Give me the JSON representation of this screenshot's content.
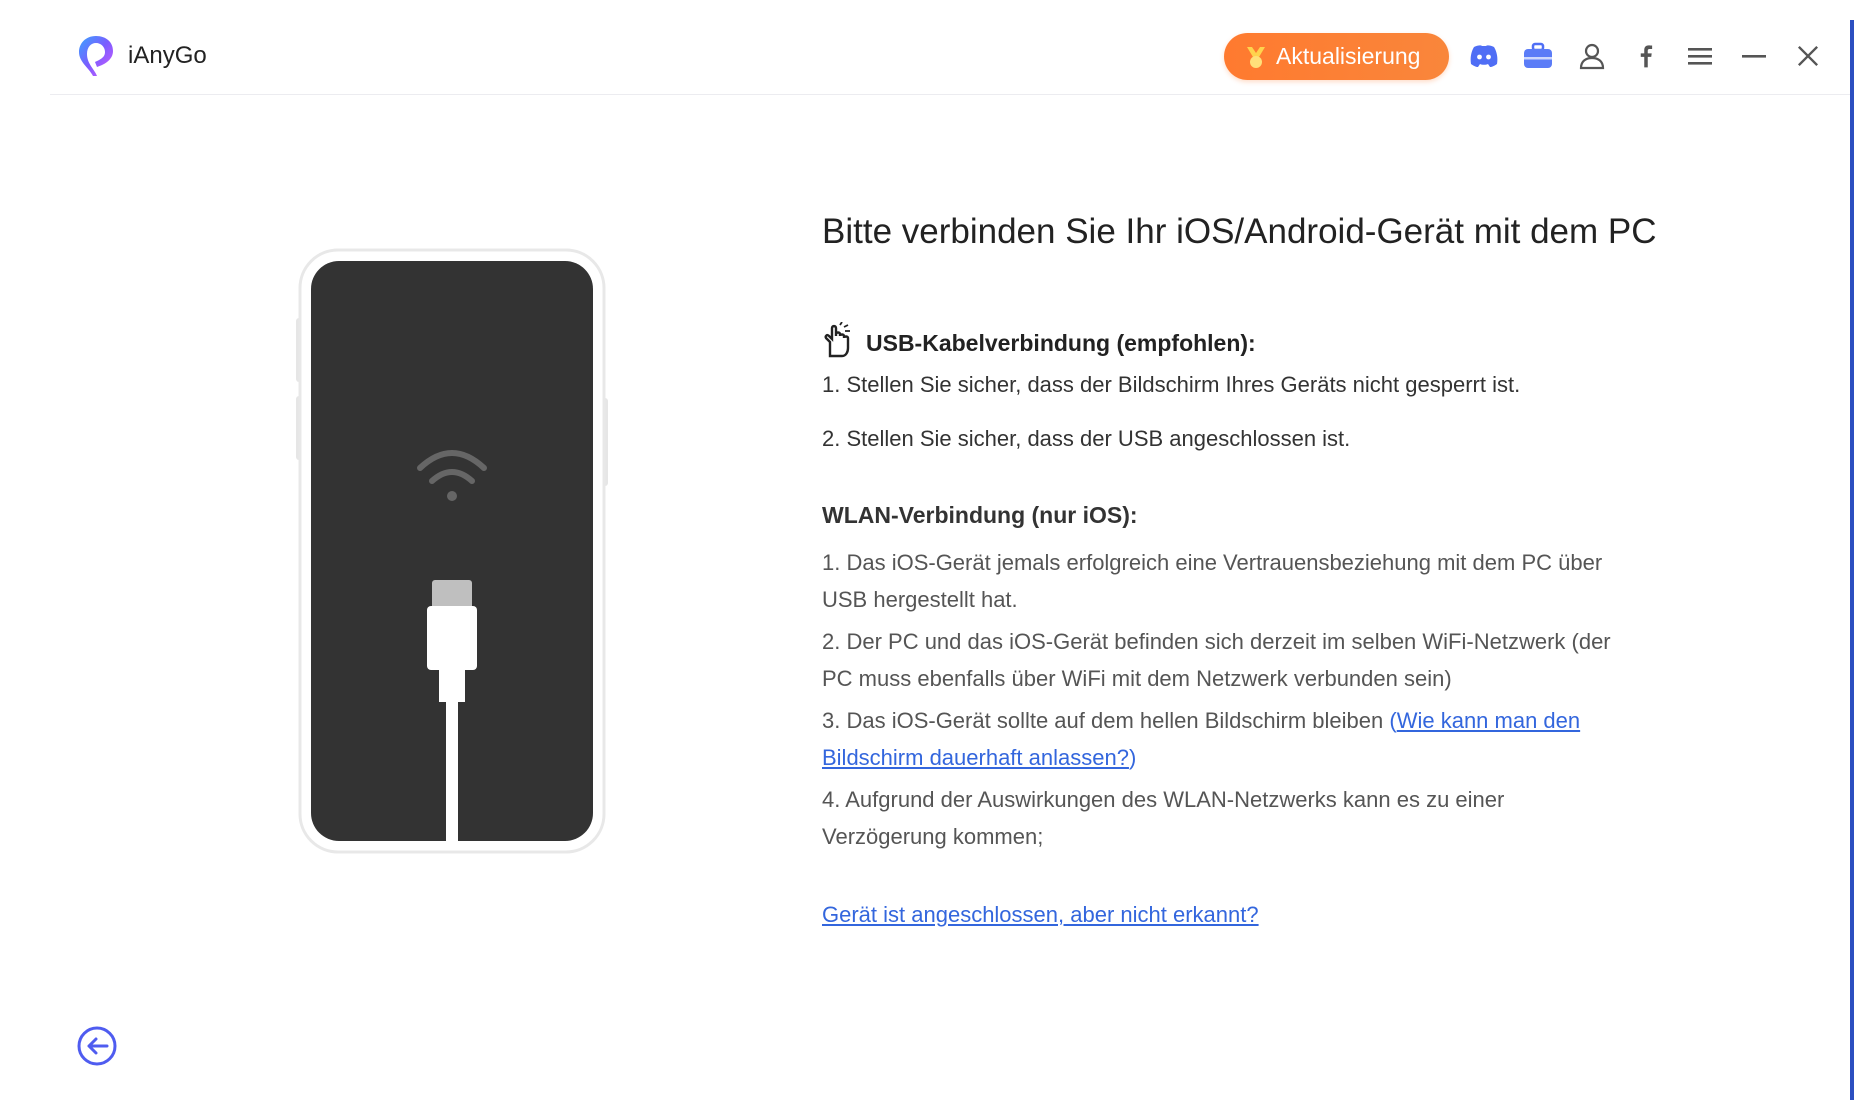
{
  "app": {
    "name": "iAnyGo"
  },
  "titlebar": {
    "upgrade_label": "Aktualisierung",
    "icons": [
      "discord-icon",
      "toolbox-icon",
      "user-icon",
      "facebook-icon",
      "menu-icon",
      "minimize-icon",
      "close-icon"
    ]
  },
  "colors": {
    "accent_orange": "#ff7a2f",
    "link_blue": "#3366dd",
    "phone_screen": "#333333",
    "brand_purple": "#6b4cf6"
  },
  "main": {
    "heading": "Bitte verbinden Sie Ihr iOS/Android-Gerät mit dem PC",
    "usb": {
      "title": "USB-Kabelverbindung (empfohlen):",
      "items": [
        "1. Stellen Sie sicher, dass der Bildschirm Ihres Geräts nicht gesperrt ist.",
        "2. Stellen Sie sicher, dass der USB angeschlossen ist."
      ]
    },
    "wlan": {
      "title": "WLAN-Verbindung (nur iOS):",
      "item1_line1": "1. Das iOS-Gerät jemals erfolgreich eine Vertrauensbeziehung mit dem PC über",
      "item1_line2": "USB hergestellt hat.",
      "item2_line1": "2. Der PC und das iOS-Gerät befinden sich derzeit im selben WiFi-Netzwerk (der",
      "item2_line2": "PC muss ebenfalls über WiFi mit dem Netzwerk verbunden sein)",
      "item3_text": "3. Das iOS-Gerät sollte auf dem hellen Bildschirm bleiben ",
      "item3_open": "(",
      "item3_link_line1": "Wie kann man den",
      "item3_link_line2": "Bildschirm dauerhaft anlassen?",
      "item3_close": ")",
      "item4_line1": "4. Aufgrund der Auswirkungen des WLAN-Netzwerks kann es zu einer",
      "item4_line2": "Verzögerung kommen;"
    },
    "help_link": "Gerät ist angeschlossen, aber nicht erkannt?"
  }
}
